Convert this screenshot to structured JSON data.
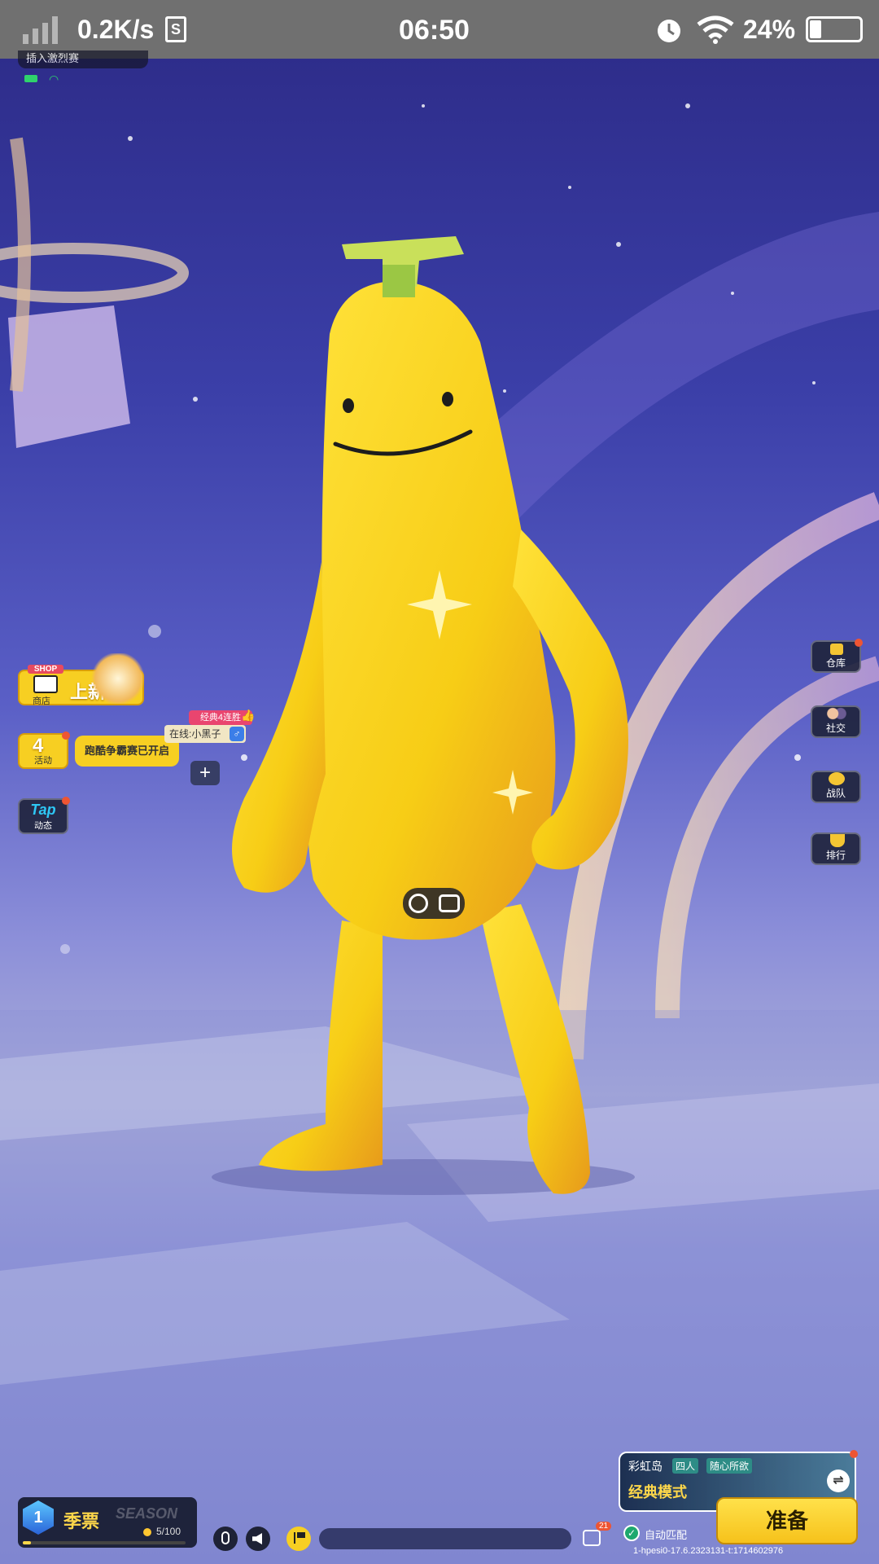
{
  "status_bar": {
    "net_speed": "0.2K/s",
    "time": "06:50",
    "battery_pct": "24%",
    "battery_level": 0.24
  },
  "top_left": {
    "join_hint": "插入激烈赛"
  },
  "left_menu": {
    "shop": {
      "badge": "SHOP",
      "sub": "商店",
      "title": "上新"
    },
    "activity": {
      "label": "活动",
      "notice": "跑酷争霸赛已开启"
    },
    "tap": {
      "logo": "Tap",
      "label": "动态"
    }
  },
  "player_tag": {
    "badge": "经典4连胜",
    "online_name": "在线:小黑子",
    "gender_icon": "male-icon"
  },
  "right_menu": [
    {
      "name": "warehouse",
      "label": "仓库",
      "icon": "box-icon"
    },
    {
      "name": "social",
      "label": "社交",
      "icon": "friends-icon"
    },
    {
      "name": "team",
      "label": "战队",
      "icon": "team-icon"
    },
    {
      "name": "rank",
      "label": "排行",
      "icon": "trophy-icon"
    }
  ],
  "character": {
    "name": "banana"
  },
  "season": {
    "level": "1",
    "title": "季票",
    "watermark": "SEASON",
    "progress": "5/100",
    "progress_value": 0.05
  },
  "bottom_bar": {
    "notif_count": "21"
  },
  "mode_card": {
    "map": "彩虹岛",
    "team_size": "四人",
    "tag": "随心所欲",
    "mode": "经典模式",
    "auto_match": "自动匹配",
    "ready": "准备",
    "version": "1-hpesi0-17.6.2323131-t:1714602976"
  }
}
